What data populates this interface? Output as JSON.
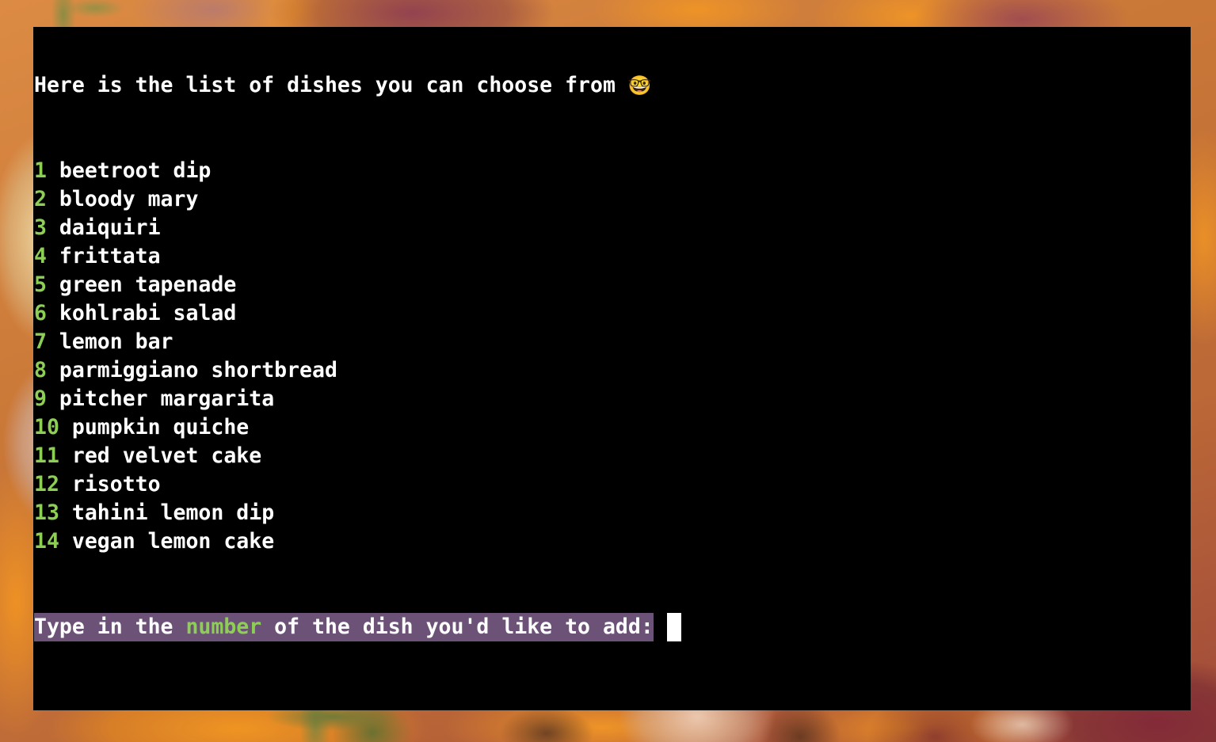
{
  "terminal": {
    "header": {
      "text": "Here is the list of dishes you can choose from ",
      "emoji": "🤓",
      "emoji_name": "nerd-face-emoji"
    },
    "dishes": [
      {
        "number": "1 ",
        "name": "beetroot dip"
      },
      {
        "number": "2 ",
        "name": "bloody mary"
      },
      {
        "number": "3 ",
        "name": "daiquiri"
      },
      {
        "number": "4 ",
        "name": "frittata"
      },
      {
        "number": "5 ",
        "name": "green tapenade"
      },
      {
        "number": "6 ",
        "name": "kohlrabi salad"
      },
      {
        "number": "7 ",
        "name": "lemon bar"
      },
      {
        "number": "8 ",
        "name": "parmiggiano shortbread"
      },
      {
        "number": "9 ",
        "name": "pitcher margarita"
      },
      {
        "number": "10 ",
        "name": "pumpkin quiche"
      },
      {
        "number": "11 ",
        "name": "red velvet cake"
      },
      {
        "number": "12 ",
        "name": "risotto"
      },
      {
        "number": "13 ",
        "name": "tahini lemon dip"
      },
      {
        "number": "14 ",
        "name": "vegan lemon cake"
      }
    ],
    "prompt": {
      "prefix": "Type in the ",
      "highlight": "number",
      "suffix": " of the dish you'd like to add:",
      "input_value": ""
    },
    "colors": {
      "background": "#000000",
      "foreground": "#ffffff",
      "number_green": "#8dce54",
      "prompt_highlight": "#6d5278",
      "cursor": "#ffffff"
    }
  },
  "desktop": {
    "wallpaper_description": "close-up photograph of onions, garlic and pumpkin"
  }
}
